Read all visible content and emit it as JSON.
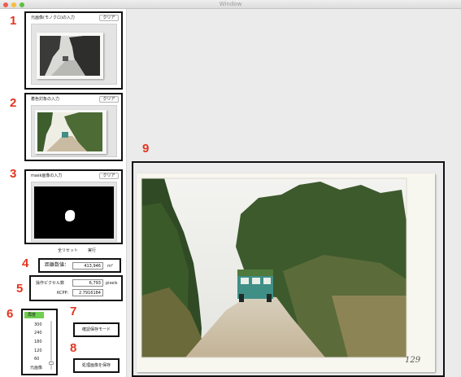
{
  "window": {
    "title": "Window"
  },
  "markers": [
    "1",
    "2",
    "3",
    "4",
    "5",
    "6",
    "7",
    "8",
    "9"
  ],
  "panel1": {
    "title": "元画像(モノクロ)の入力",
    "clear_label": "クリア"
  },
  "panel2": {
    "title": "着色対象の入力",
    "clear_label": "クリア"
  },
  "panel3": {
    "title": "mask画像の入力",
    "clear_label": "クリア"
  },
  "actions": {
    "select_all_label": "全リセット",
    "run_label": "実行"
  },
  "panel4": {
    "label": "距離数値：",
    "value": "413,946",
    "unit": "m²"
  },
  "panel5": {
    "pixel_label": "操作ピクセル数",
    "pixel_value": "6,793",
    "pixel_unit": "pixels",
    "kcpp_label": "KCPP:",
    "kcpp_value": "2.7916184"
  },
  "panel6": {
    "header": "再度",
    "levels": [
      "300",
      "240",
      "180",
      "120",
      "60"
    ],
    "footer": "元画像",
    "slider_value_fraction": 0.1
  },
  "panel7": {
    "label": "確認保存モード"
  },
  "panel8": {
    "label": "処理画像を保存"
  },
  "photo": {
    "caption": "129"
  },
  "colors": {
    "marker": "#e2351f",
    "header_green": "#6fcf4f",
    "truck": "#3f8f86"
  }
}
